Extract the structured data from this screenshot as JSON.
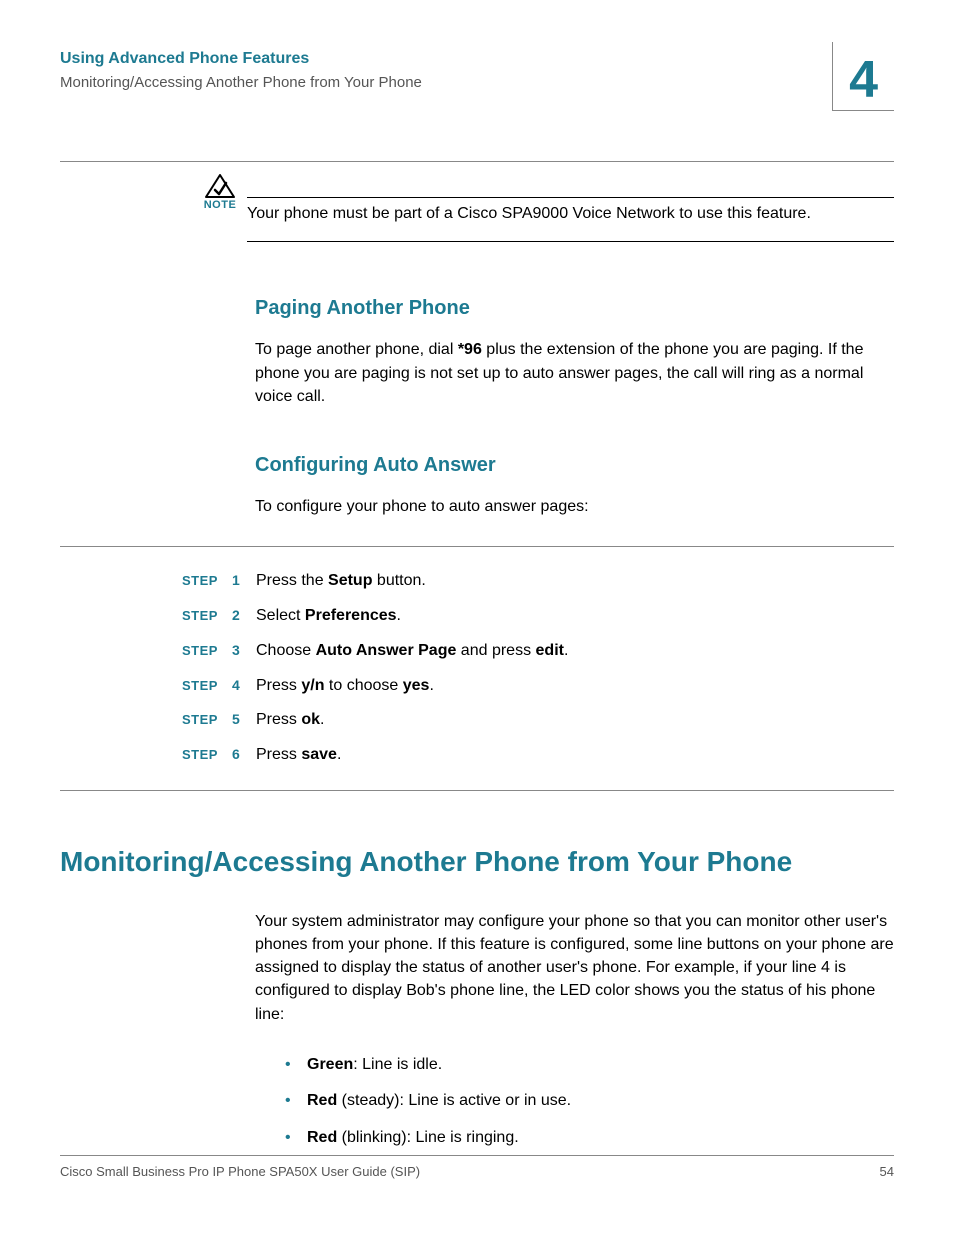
{
  "header": {
    "title": "Using Advanced Phone Features",
    "subtitle": "Monitoring/Accessing Another Phone from Your Phone",
    "chapter": "4"
  },
  "note": {
    "label": "NOTE",
    "text": "Your phone must be part of a Cisco SPA9000 Voice Network to use this feature."
  },
  "sections": {
    "paging": {
      "heading": "Paging Another Phone",
      "body_pre": "To page another phone, dial ",
      "body_bold": "*96",
      "body_post": " plus the extension of the phone you are paging. If the phone you are paging is not set up to auto answer pages, the call will ring as a normal voice call."
    },
    "config": {
      "heading": "Configuring Auto Answer",
      "intro": "To configure your phone to auto answer pages:"
    }
  },
  "step_label": "STEP",
  "steps": [
    {
      "num": "1",
      "pre": "Press the ",
      "b1": "Setup",
      "mid": " button.",
      "b2": "",
      "post": ""
    },
    {
      "num": "2",
      "pre": "Select ",
      "b1": "Preferences",
      "mid": ".",
      "b2": "",
      "post": ""
    },
    {
      "num": "3",
      "pre": "Choose ",
      "b1": "Auto Answer Page",
      "mid": " and press ",
      "b2": "edit",
      "post": "."
    },
    {
      "num": "4",
      "pre": "Press ",
      "b1": "y/n",
      "mid": " to choose ",
      "b2": "yes",
      "post": "."
    },
    {
      "num": "5",
      "pre": "Press ",
      "b1": "ok",
      "mid": ".",
      "b2": "",
      "post": ""
    },
    {
      "num": "6",
      "pre": "Press ",
      "b1": "save",
      "mid": ".",
      "b2": "",
      "post": ""
    }
  ],
  "monitoring": {
    "heading": "Monitoring/Accessing Another Phone from Your Phone",
    "body": "Your system administrator may configure your phone so that you can monitor other user's phones from your phone. If this feature is configured, some line buttons on your phone are assigned to display the status of another user's phone. For example, if your line 4 is configured to display Bob's phone line, the LED color shows you the status of his phone line:",
    "bullets": [
      {
        "b": "Green",
        "rest": ": Line is idle."
      },
      {
        "b": "Red",
        "rest": " (steady): Line is active or in use."
      },
      {
        "b": "Red",
        "rest": " (blinking): Line is ringing."
      }
    ]
  },
  "footer": {
    "left": "Cisco Small Business Pro IP Phone SPA50X User Guide (SIP)",
    "right": "54"
  }
}
